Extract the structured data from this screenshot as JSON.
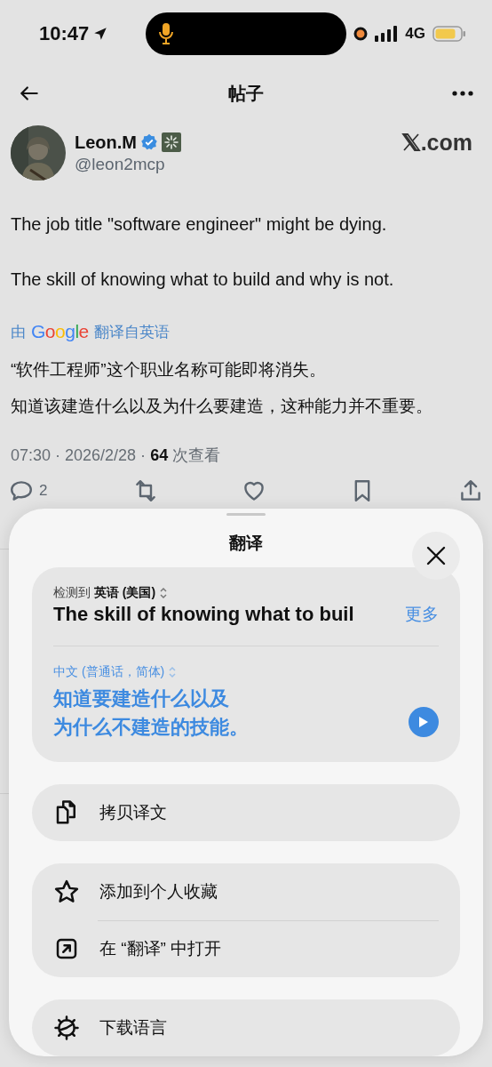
{
  "status_bar": {
    "time": "10:47",
    "network": "4G"
  },
  "header": {
    "title": "帖子"
  },
  "author": {
    "name": "Leon.M",
    "handle": "@leon2mcp",
    "verified": true,
    "site": ".com"
  },
  "post": {
    "paragraphs": [
      "The job title \"software engineer\" might be dying.",
      "The skill of knowing what to build and why is not."
    ],
    "translation_credit": {
      "prefix": "由",
      "brand": "Google",
      "label": "翻译自英语"
    },
    "translated": [
      "“软件工程师”这个职业名称可能即将消失。",
      "知道该建造什么以及为什么要建造，这种能力并不重要。"
    ],
    "meta": "07:30 · 2026/2/28 · **64** 次查看",
    "actions": [
      {
        "kind": "reply",
        "count": "2"
      },
      {
        "kind": "repost"
      },
      {
        "kind": "like"
      },
      {
        "kind": "bookmark"
      },
      {
        "kind": "share"
      }
    ]
  },
  "sheet": {
    "title": "翻译",
    "source": {
      "language": "检测到 **英语 (美国)**",
      "text": "The skill of knowing what to buil",
      "more": "更多"
    },
    "target": {
      "language": "中文 (普通话，简体)",
      "lines": [
        "知道要建造什么以及",
        "为什么不建造的技能。"
      ]
    },
    "groups": [
      [
        {
          "kind": "copy",
          "label": "拷贝译文"
        }
      ],
      [
        {
          "kind": "star",
          "label": "添加到个人收藏"
        },
        {
          "kind": "open",
          "label": "在 “翻译” 中打开"
        }
      ],
      [
        {
          "kind": "download",
          "label": "下载语言"
        }
      ]
    ]
  }
}
